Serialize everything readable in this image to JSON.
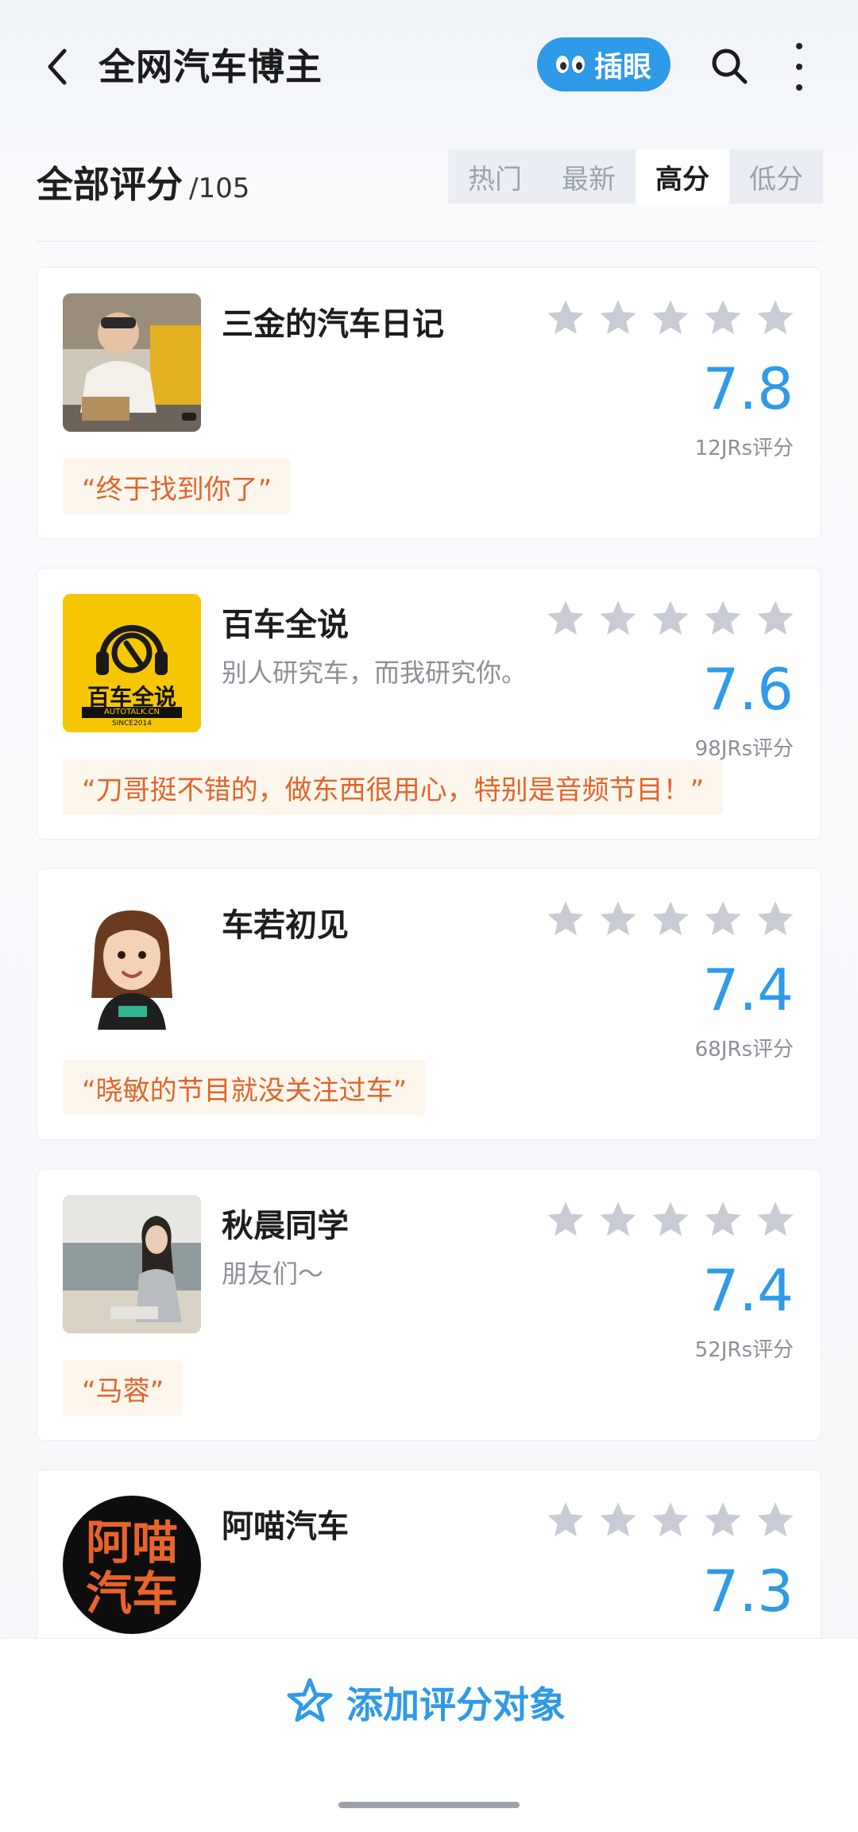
{
  "header": {
    "title": "全网汽车博主",
    "peek_label": "插眼"
  },
  "section": {
    "title": "全部评分",
    "count": "/105",
    "tabs": [
      {
        "label": "热门",
        "active": false
      },
      {
        "label": "最新",
        "active": false
      },
      {
        "label": "高分",
        "active": true
      },
      {
        "label": "低分",
        "active": false
      }
    ]
  },
  "items": [
    {
      "name": "三金的汽车日记",
      "subtitle": "",
      "score": "7.8",
      "count": "12JRs评分",
      "quote": "“终于找到你了”",
      "avatar": "person-photo"
    },
    {
      "name": "百车全说",
      "subtitle": "别人研究车，而我研究你。",
      "score": "7.6",
      "count": "98JRs评分",
      "quote": "“刀哥挺不错的，做东西很用心，特别是音频节目！”",
      "avatar": "logo-yellow",
      "logo_text": "百车全说",
      "logo_sub": "AUTOTALK.CN",
      "logo_since": "SINCE2014"
    },
    {
      "name": "车若初见",
      "subtitle": "",
      "score": "7.4",
      "count": "68JRs评分",
      "quote": "“晓敏的节目就没关注过车”",
      "avatar": "cartoon-woman"
    },
    {
      "name": "秋晨同学",
      "subtitle": "朋友们～",
      "score": "7.4",
      "count": "52JRs评分",
      "quote": "“马蓉”",
      "avatar": "beach-photo"
    },
    {
      "name": "阿喵汽车",
      "subtitle": "",
      "score": "7.3",
      "count": "",
      "quote": "",
      "avatar": "logo-black",
      "logo_text_1": "阿喵",
      "logo_text_2": "汽车"
    }
  ],
  "footer": {
    "add_label": "添加评分对象"
  },
  "colors": {
    "accent": "#2f9ae8",
    "quote": "#e0652d",
    "star": "#c9ccd4"
  }
}
